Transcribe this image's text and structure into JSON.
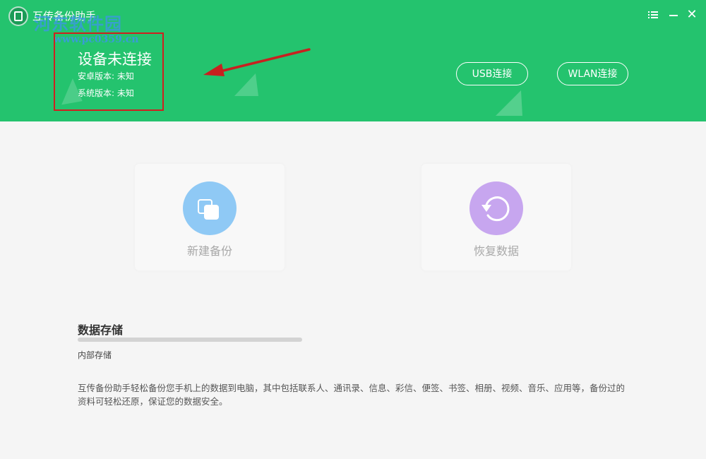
{
  "app": {
    "title": "互传备份助手",
    "watermark": {
      "main": "河东软件园",
      "url": "www.pc0359.cn"
    }
  },
  "header": {
    "device_status": "设备未连接",
    "android_version": "安卓版本: 未知",
    "system_version": "系统版本: 未知",
    "usb_button": "USB连接",
    "wlan_button": "WLAN连接"
  },
  "window_controls": {
    "menu_icon": "menu-icon",
    "minimize_icon": "minimize-icon",
    "close_icon": "close-icon",
    "close_glyph": "✕"
  },
  "cards": {
    "backup": {
      "label": "新建备份",
      "icon": "copy-icon",
      "color": "#8fc9f5"
    },
    "restore": {
      "label": "恢复数据",
      "icon": "restore-icon",
      "color": "#c7a6ef"
    }
  },
  "storage": {
    "title": "数据存储",
    "label": "内部存储",
    "fill_fraction": 0
  },
  "description": "互传备份助手轻松备份您手机上的数据到电脑，其中包括联系人、通讯录、信息、彩信、便签、书签、相册、视频、音乐、应用等，备份过的资料可轻松还原，保证您的数据安全。",
  "colors": {
    "header_green": "#24c36e",
    "highlight_red": "#d01f1f",
    "annotation_arrow": "#c8201f",
    "watermark_blue": "#3c96e6"
  }
}
